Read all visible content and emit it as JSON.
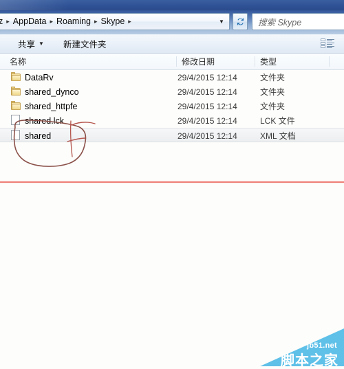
{
  "window": {
    "chrome_color": "#2f5296"
  },
  "addressbar": {
    "crumbs": [
      {
        "label": "z"
      },
      {
        "label": "AppData"
      },
      {
        "label": "Roaming"
      },
      {
        "label": "Skype"
      }
    ],
    "separator": "▸",
    "dropdown_icon": "chevron-down-icon",
    "dropdown_glyph": "▼",
    "refresh_icon": "refresh-icon"
  },
  "search": {
    "placeholder": "搜索 Skype",
    "value": ""
  },
  "toolbar": {
    "share_label": "共享",
    "share_caret": "▼",
    "new_folder_label": "新建文件夹",
    "view_icon": "view-options-icon"
  },
  "columns": {
    "name": "名称",
    "date_modified": "修改日期",
    "type": "类型",
    "sort_icon": "sort-ascending-icon"
  },
  "files": [
    {
      "name": "DataRv",
      "date": "29/4/2015 12:14",
      "type": "文件夹",
      "icon": "folder-icon",
      "selected": false
    },
    {
      "name": "shared_dynco",
      "date": "29/4/2015 12:14",
      "type": "文件夹",
      "icon": "folder-icon",
      "selected": false
    },
    {
      "name": "shared_httpfe",
      "date": "29/4/2015 12:14",
      "type": "文件夹",
      "icon": "folder-icon",
      "selected": false
    },
    {
      "name": "shared.lck",
      "date": "29/4/2015 12:14",
      "type": "LCK 文件",
      "icon": "file-icon",
      "selected": false
    },
    {
      "name": "shared",
      "date": "29/4/2015 12:14",
      "type": "XML 文档",
      "icon": "file-icon",
      "selected": true
    }
  ],
  "annotations": {
    "oval_color": "#b5564e",
    "line_color": "#ef8179",
    "oval_label": "highlight-oval-around-shared-files",
    "line_label": "horizontal-red-divider"
  },
  "watermark": {
    "site": "jb51.net",
    "name": "脚本之家",
    "color": "#5fc0e8"
  }
}
